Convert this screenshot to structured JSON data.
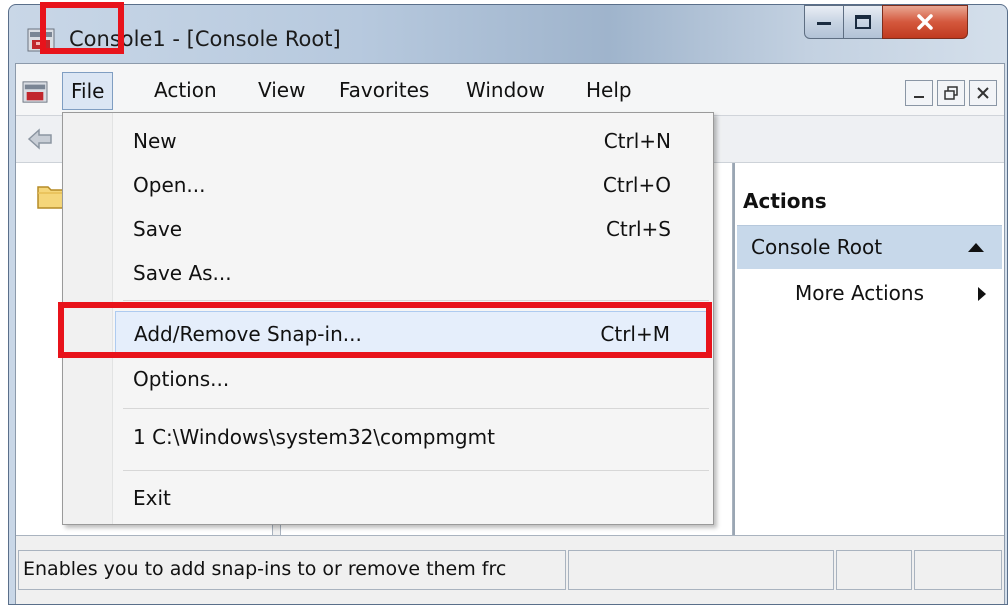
{
  "window": {
    "title": "Console1 - [Console Root]",
    "accent_highlight_color": "#e8131b"
  },
  "menubar": {
    "items": [
      {
        "label": "File"
      },
      {
        "label": "Action"
      },
      {
        "label": "View"
      },
      {
        "label": "Favorites"
      },
      {
        "label": "Window"
      },
      {
        "label": "Help"
      }
    ]
  },
  "file_menu": {
    "items": [
      {
        "label": "New",
        "shortcut": "Ctrl+N"
      },
      {
        "label": "Open...",
        "shortcut": "Ctrl+O"
      },
      {
        "label": "Save",
        "shortcut": "Ctrl+S"
      },
      {
        "label": "Save As...",
        "shortcut": ""
      },
      {
        "label": "Add/Remove Snap-in...",
        "shortcut": "Ctrl+M"
      },
      {
        "label": "Options...",
        "shortcut": ""
      },
      {
        "label": "1 C:\\Windows\\system32\\compmgmt",
        "shortcut": ""
      },
      {
        "label": "Exit",
        "shortcut": ""
      }
    ]
  },
  "actions_pane": {
    "header": "Actions",
    "section": "Console Root",
    "more_actions": "More Actions"
  },
  "statusbar": {
    "text": "Enables you to add snap-ins to or remove them frc"
  }
}
